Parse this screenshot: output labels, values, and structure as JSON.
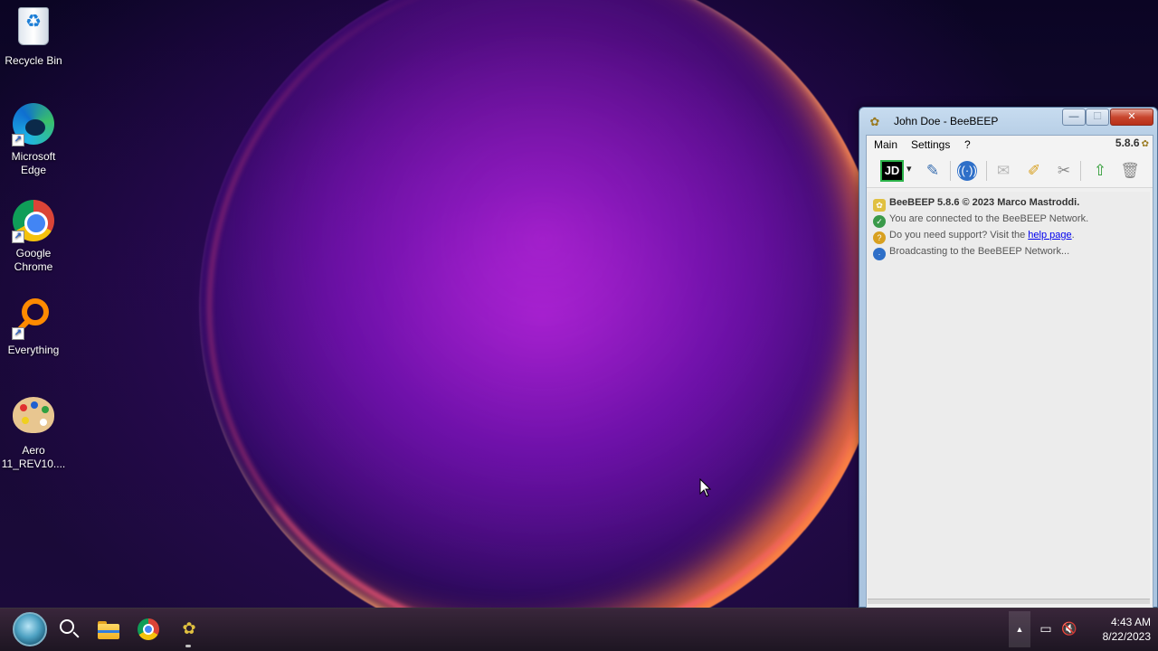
{
  "desktop": {
    "icons": [
      {
        "label": "Recycle Bin"
      },
      {
        "label": "Microsoft Edge"
      },
      {
        "label": "Google Chrome"
      },
      {
        "label": "Everything"
      },
      {
        "label": "Aero 11_REV10...."
      }
    ],
    "shortcut_glyph": "↗"
  },
  "window": {
    "title": "John Doe - BeeBEEP",
    "caption": {
      "minimize": "—",
      "maximize": "☐",
      "close": "✕"
    },
    "menu": [
      "Main",
      "Settings",
      "?"
    ],
    "version": "5.8.6",
    "toolbar": {
      "user_initials": "JD",
      "dropdown_glyph": "▾",
      "buttons": [
        "edit-profile",
        "network",
        "message",
        "compose",
        "tools",
        "update",
        "trash"
      ]
    },
    "log": {
      "line1": "BeeBEEP 5.8.6 © 2023 Marco Mastroddi.",
      "line2": "You are connected to the BeeBEEP Network.",
      "line3_prefix": "Do you need support? Visit the ",
      "line3_link": "help page",
      "line3_suffix": ".",
      "line4": "Broadcasting to the BeeBEEP Network..."
    }
  },
  "taskbar": {
    "tray_expand_glyph": "▲",
    "time": "4:43 AM",
    "date": "8/22/2023"
  },
  "colors": {
    "accent": "#2cb34a",
    "link": "#0000ee",
    "close_button": "#c8462e"
  }
}
